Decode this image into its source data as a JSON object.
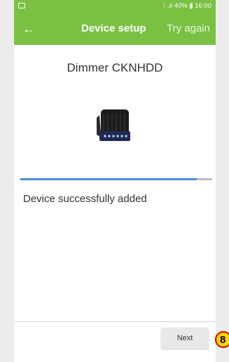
{
  "status_bar": {
    "right_text": "⁝ .ıl 40% ▮ 16:00",
    "battery": "40%",
    "time": "16:00"
  },
  "app_bar": {
    "back_icon": "arrow-left-icon",
    "title": "Device setup",
    "action_label": "Try again"
  },
  "device": {
    "name": "Dimmer CKNHDD",
    "image_icon": "dimmer-module-icon"
  },
  "progress": {
    "value_fraction": 0.92,
    "color": "#4a90d9",
    "status_text": "Device successfully added"
  },
  "footer": {
    "next_label": "Next"
  },
  "annotation_badge": {
    "label": "8"
  },
  "colors": {
    "brand_green": "#7ac143"
  }
}
